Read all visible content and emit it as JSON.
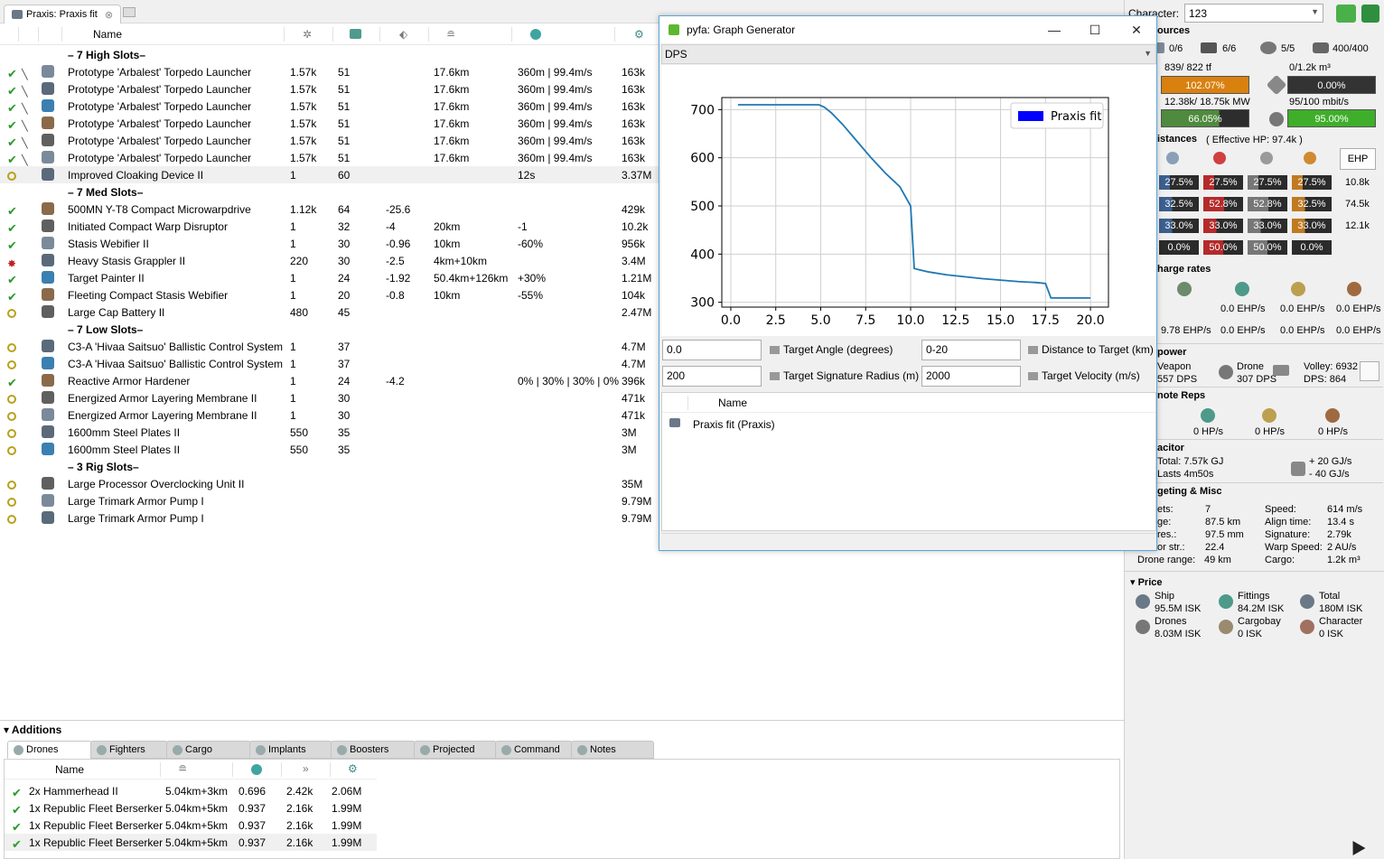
{
  "tab": {
    "title": "Praxis: Praxis fit"
  },
  "columns": {
    "name": "Name"
  },
  "rows": [
    {
      "kind": "header",
      "name": "– 7 High Slots–"
    },
    {
      "kind": "module",
      "state": "ok",
      "name": "Prototype 'Arbalest' Torpedo Launcher",
      "c1": "1.57k",
      "c2": "51",
      "c3": "",
      "c4": "17.6km",
      "c5": "360m | 99.4m/s",
      "c6": "163k"
    },
    {
      "kind": "module",
      "state": "ok",
      "name": "Prototype 'Arbalest' Torpedo Launcher",
      "c1": "1.57k",
      "c2": "51",
      "c3": "",
      "c4": "17.6km",
      "c5": "360m | 99.4m/s",
      "c6": "163k"
    },
    {
      "kind": "module",
      "state": "ok",
      "name": "Prototype 'Arbalest' Torpedo Launcher",
      "c1": "1.57k",
      "c2": "51",
      "c3": "",
      "c4": "17.6km",
      "c5": "360m | 99.4m/s",
      "c6": "163k"
    },
    {
      "kind": "module",
      "state": "ok",
      "name": "Prototype 'Arbalest' Torpedo Launcher",
      "c1": "1.57k",
      "c2": "51",
      "c3": "",
      "c4": "17.6km",
      "c5": "360m | 99.4m/s",
      "c6": "163k"
    },
    {
      "kind": "module",
      "state": "ok",
      "name": "Prototype 'Arbalest' Torpedo Launcher",
      "c1": "1.57k",
      "c2": "51",
      "c3": "",
      "c4": "17.6km",
      "c5": "360m | 99.4m/s",
      "c6": "163k"
    },
    {
      "kind": "module",
      "state": "ok",
      "name": "Prototype 'Arbalest' Torpedo Launcher",
      "c1": "1.57k",
      "c2": "51",
      "c3": "",
      "c4": "17.6km",
      "c5": "360m | 99.4m/s",
      "c6": "163k"
    },
    {
      "kind": "module",
      "state": "off",
      "name": "Improved Cloaking Device II",
      "c1": "1",
      "c2": "60",
      "c3": "",
      "c4": "",
      "c5": "12s",
      "c6": "3.37M",
      "selected": true
    },
    {
      "kind": "header",
      "name": "– 7 Med Slots–"
    },
    {
      "kind": "module",
      "state": "ok",
      "name": "500MN Y-T8 Compact Microwarpdrive",
      "c1": "1.12k",
      "c2": "64",
      "c3": "-25.6",
      "c4": "",
      "c5": "",
      "c6": "429k"
    },
    {
      "kind": "module",
      "state": "ok",
      "name": "Initiated Compact Warp Disruptor",
      "c1": "1",
      "c2": "32",
      "c3": "-4",
      "c4": "20km",
      "c5": "-1",
      "c6": "10.2k"
    },
    {
      "kind": "module",
      "state": "ok",
      "name": "Stasis Webifier II",
      "c1": "1",
      "c2": "30",
      "c3": "-0.96",
      "c4": "10km",
      "c5": "-60%",
      "c6": "956k"
    },
    {
      "kind": "module",
      "state": "over",
      "name": "Heavy Stasis Grappler II",
      "c1": "220",
      "c2": "30",
      "c3": "-2.5",
      "c4": "4km+10km",
      "c5": "",
      "c6": "3.4M"
    },
    {
      "kind": "module",
      "state": "ok",
      "name": "Target Painter II",
      "c1": "1",
      "c2": "24",
      "c3": "-1.92",
      "c4": "50.4km+126km",
      "c5": "+30%",
      "c6": "1.21M"
    },
    {
      "kind": "module",
      "state": "ok",
      "name": "Fleeting Compact Stasis Webifier",
      "c1": "1",
      "c2": "20",
      "c3": "-0.8",
      "c4": "10km",
      "c5": "-55%",
      "c6": "104k"
    },
    {
      "kind": "module",
      "state": "off",
      "name": "Large Cap Battery II",
      "c1": "480",
      "c2": "45",
      "c3": "",
      "c4": "",
      "c5": "",
      "c6": "2.47M"
    },
    {
      "kind": "header",
      "name": "– 7 Low Slots–"
    },
    {
      "kind": "module",
      "state": "off",
      "name": "C3-A 'Hivaa Saitsuo' Ballistic Control System",
      "c1": "1",
      "c2": "37",
      "c3": "",
      "c4": "",
      "c5": "",
      "c6": "4.7M"
    },
    {
      "kind": "module",
      "state": "off",
      "name": "C3-A 'Hivaa Saitsuo' Ballistic Control System",
      "c1": "1",
      "c2": "37",
      "c3": "",
      "c4": "",
      "c5": "",
      "c6": "4.7M"
    },
    {
      "kind": "module",
      "state": "ok",
      "name": "Reactive Armor Hardener",
      "c1": "1",
      "c2": "24",
      "c3": "-4.2",
      "c4": "",
      "c5": "0% | 30% | 30% | 0%",
      "c6": "396k"
    },
    {
      "kind": "module",
      "state": "off",
      "name": "Energized Armor Layering Membrane II",
      "c1": "1",
      "c2": "30",
      "c3": "",
      "c4": "",
      "c5": "",
      "c6": "471k"
    },
    {
      "kind": "module",
      "state": "off",
      "name": "Energized Armor Layering Membrane II",
      "c1": "1",
      "c2": "30",
      "c3": "",
      "c4": "",
      "c5": "",
      "c6": "471k"
    },
    {
      "kind": "module",
      "state": "off",
      "name": "1600mm Steel Plates II",
      "c1": "550",
      "c2": "35",
      "c3": "",
      "c4": "",
      "c5": "",
      "c6": "3M"
    },
    {
      "kind": "module",
      "state": "off",
      "name": "1600mm Steel Plates II",
      "c1": "550",
      "c2": "35",
      "c3": "",
      "c4": "",
      "c5": "",
      "c6": "3M"
    },
    {
      "kind": "header",
      "name": "– 3 Rig Slots–"
    },
    {
      "kind": "module",
      "state": "off",
      "name": "Large Processor Overclocking Unit II",
      "c1": "",
      "c2": "",
      "c3": "",
      "c4": "",
      "c5": "",
      "c6": "35M"
    },
    {
      "kind": "module",
      "state": "off",
      "name": "Large Trimark Armor Pump I",
      "c1": "",
      "c2": "",
      "c3": "",
      "c4": "",
      "c5": "",
      "c6": "9.79M"
    },
    {
      "kind": "module",
      "state": "off",
      "name": "Large Trimark Armor Pump I",
      "c1": "",
      "c2": "",
      "c3": "",
      "c4": "",
      "c5": "",
      "c6": "9.79M"
    }
  ],
  "additions": {
    "title": "Additions",
    "tabs": [
      "Drones",
      "Fighters",
      "Cargo",
      "Implants",
      "Boosters",
      "Projected",
      "Command",
      "Notes"
    ],
    "drones_header": {
      "name": "Name"
    },
    "drones": [
      {
        "name": "2x Hammerhead II",
        "range": "5.04km+3km",
        "track": "0.696",
        "dps": "2.42k",
        "price": "2.06M"
      },
      {
        "name": "1x Republic Fleet Berserker",
        "range": "5.04km+5km",
        "track": "0.937",
        "dps": "2.16k",
        "price": "1.99M"
      },
      {
        "name": "1x Republic Fleet Berserker",
        "range": "5.04km+5km",
        "track": "0.937",
        "dps": "2.16k",
        "price": "1.99M"
      },
      {
        "name": "1x Republic Fleet Berserker",
        "range": "5.04km+5km",
        "track": "0.937",
        "dps": "2.16k",
        "price": "1.99M"
      }
    ]
  },
  "stats": {
    "character_label": "Character:",
    "character_value": "123",
    "resources_title": "ources",
    "hardpoints": [
      "0/6",
      "6/6",
      "5/5",
      "400/400"
    ],
    "cpu_text": "839/ 822 tf",
    "cpu_pct": "102.07%",
    "bay_text": "0/1.2k m³",
    "bay_pct": "0.00%",
    "pg_text": "12.38k/ 18.75k MW",
    "pg_pct": "66.05%",
    "bw_text": "95/100 mbit/s",
    "bw_pct": "95.00%",
    "resist_title": "istances",
    "ehp_label": "( Effective HP: 97.4k )",
    "ehp_button": "EHP",
    "resist_rows": [
      {
        "vals": [
          "27.5%",
          "27.5%",
          "27.5%",
          "27.5%"
        ],
        "hp": "10.8k"
      },
      {
        "vals": [
          "32.5%",
          "52.8%",
          "52.8%",
          "32.5%"
        ],
        "hp": "74.5k"
      },
      {
        "vals": [
          "33.0%",
          "33.0%",
          "33.0%",
          "33.0%"
        ],
        "hp": "12.1k"
      },
      {
        "vals": [
          "0.0%",
          "50.0%",
          "50.0%",
          "0.0%"
        ],
        "hp": ""
      }
    ],
    "recharge_title": "harge rates",
    "recharge_a": [
      "0.0 EHP/s",
      "0.0 EHP/s",
      "0.0 EHP/s"
    ],
    "recharge_b": [
      "9.78 EHP/s",
      "0.0 EHP/s",
      "0.0 EHP/s",
      "0.0 EHP/s"
    ],
    "firepower_title": "power",
    "weapon_label": "Veapon",
    "weapon_dps": "557 DPS",
    "drone_label": "Drone",
    "drone_dps": "307 DPS",
    "volley": "Volley: 6932",
    "total_dps": "DPS: 864",
    "remote_title": "note Reps",
    "remote_vals": [
      "0 HP/s",
      "0 HP/s",
      "0 HP/s"
    ],
    "cap_title": "acitor",
    "cap_total": "Total: 7.57k GJ",
    "cap_lasts": "Lasts 4m50s",
    "cap_gain": "+ 20 GJ/s",
    "cap_loss": "- 40 GJ/s",
    "misc_title": "geting & Misc",
    "misc_left": [
      {
        "k": "ets:",
        "v": "7"
      },
      {
        "k": "ge:",
        "v": "87.5 km"
      },
      {
        "k": "res.:",
        "v": "97.5 mm"
      },
      {
        "k": "or str.:",
        "v": "22.4"
      },
      {
        "k": "Drone range:",
        "v": "49 km"
      }
    ],
    "misc_right": [
      {
        "k": "Speed:",
        "v": "614 m/s"
      },
      {
        "k": "Align time:",
        "v": "13.4 s"
      },
      {
        "k": "Signature:",
        "v": "2.79k"
      },
      {
        "k": "Warp Speed:",
        "v": "2 AU/s"
      },
      {
        "k": "Cargo:",
        "v": "1.2k m³"
      }
    ],
    "price_title": "Price",
    "prices": [
      {
        "label": "Ship",
        "value": "95.5M ISK"
      },
      {
        "label": "Fittings",
        "value": "84.2M ISK"
      },
      {
        "label": "Total",
        "value": "180M ISK"
      },
      {
        "label": "Drones",
        "value": "8.03M ISK"
      },
      {
        "label": "Cargobay",
        "value": "0 ISK"
      },
      {
        "label": "Character",
        "value": "0 ISK"
      }
    ]
  },
  "graph_window": {
    "title": "pyfa: Graph Generator",
    "selector": "DPS",
    "field1_value": "0.0",
    "field1_label": "Target Angle (degrees)",
    "field2_value": "0-20",
    "field2_label": "Distance to Target (km)",
    "field3_value": "200",
    "field3_label": "Target Signature Radius (m)",
    "field4_value": "2000",
    "field4_label": "Target Velocity (m/s)",
    "list_header": "Name",
    "list_item": "Praxis fit (Praxis)"
  },
  "chart_data": {
    "type": "line",
    "series": [
      {
        "name": "Praxis fit",
        "color": "#1f77b4",
        "x": [
          0.4,
          2.0,
          4.0,
          4.9,
          5.2,
          5.6,
          6.2,
          7.0,
          7.8,
          8.6,
          9.4,
          10.0,
          10.2,
          11.0,
          12.0,
          13.0,
          14.0,
          15.0,
          16.0,
          17.0,
          17.5,
          17.8,
          18.5,
          19.5,
          20.0
        ],
        "y": [
          710,
          710,
          710,
          710,
          705,
          693,
          670,
          635,
          600,
          568,
          540,
          500,
          370,
          363,
          357,
          353,
          349,
          346,
          343,
          341,
          339,
          309,
          309,
          309,
          309
        ]
      }
    ],
    "xlim": [
      -0.5,
      21
    ],
    "ylim": [
      290,
      725
    ],
    "xticks": [
      "0.0",
      "2.5",
      "5.0",
      "7.5",
      "10.0",
      "12.5",
      "15.0",
      "17.5",
      "20.0"
    ],
    "yticks": [
      "300",
      "400",
      "500",
      "600",
      "700"
    ],
    "legend": "top-right",
    "grid": true
  }
}
